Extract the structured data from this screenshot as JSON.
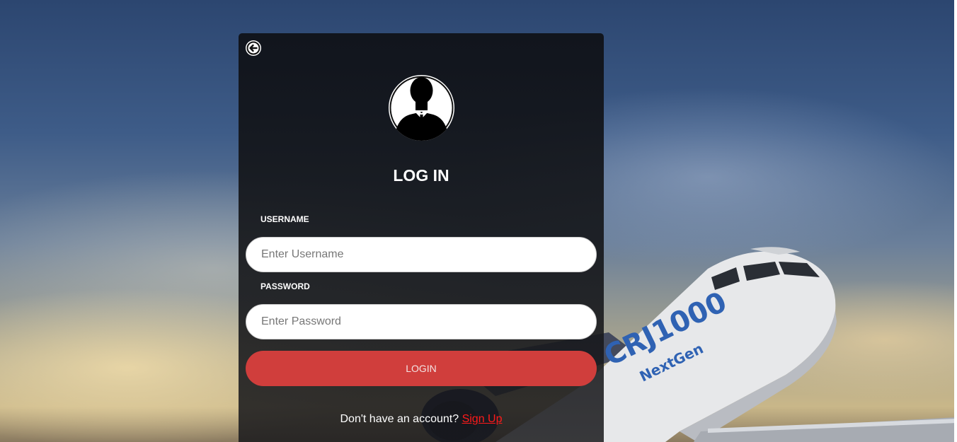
{
  "background": {
    "airline_livery_text": "CRJ1000",
    "livery_subtext": "NextGen"
  },
  "card": {
    "back_icon": "arrow-left-circle-icon",
    "avatar_icon": "user-avatar-icon",
    "title": "LOG IN",
    "username": {
      "label": "USERNAME",
      "value": "",
      "placeholder": "Enter Username"
    },
    "password": {
      "label": "PASSWORD",
      "value": "",
      "placeholder": "Enter Password"
    },
    "login_label": "LOGIN",
    "signup_prompt": "Don't have an account?",
    "signup_link": "Sign Up"
  },
  "colors": {
    "login_button": "#d03e3c",
    "signup_link": "#ff1a1a",
    "card_bg": "#16181c"
  }
}
